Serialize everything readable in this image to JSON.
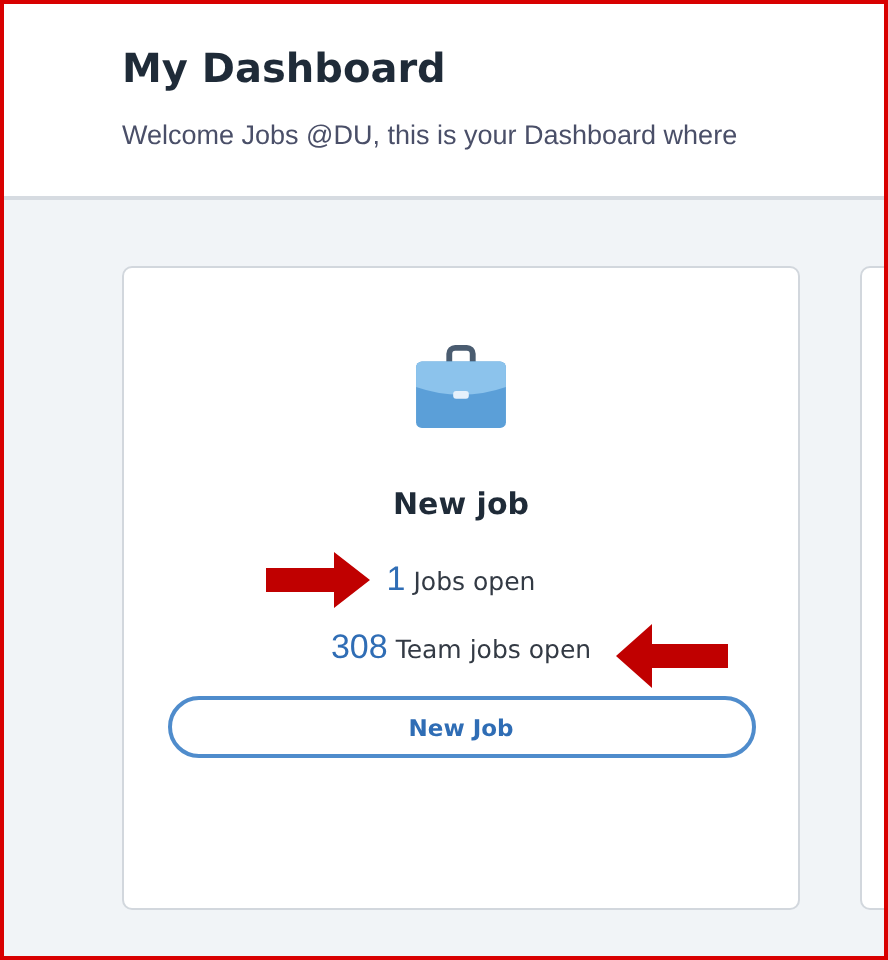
{
  "header": {
    "title": "My Dashboard",
    "welcome": "Welcome Jobs @DU, this is your Dashboard where"
  },
  "cards": [
    {
      "kind": "jobs",
      "title": "New job",
      "stats": [
        {
          "count": "1",
          "label": "Jobs open",
          "arrow_before": true,
          "arrow_after": false
        },
        {
          "count": "308",
          "label": "Team jobs open",
          "arrow_before": false,
          "arrow_after": true
        }
      ],
      "button": "New Job"
    }
  ]
}
